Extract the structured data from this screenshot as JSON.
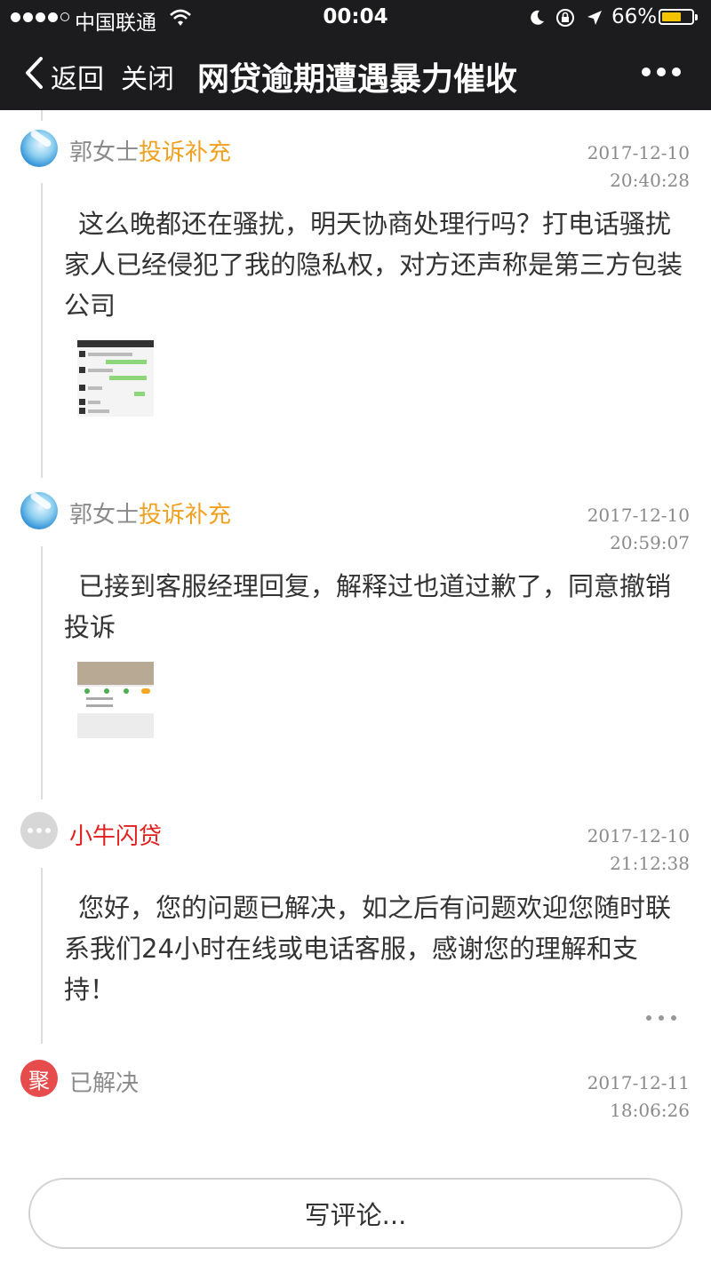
{
  "status_bar": {
    "carrier": "中国联通",
    "time": "00:04",
    "battery": "66%",
    "battery_level": 0.66
  },
  "nav": {
    "back_label": "返回",
    "close_label": "关闭",
    "title": "网贷逾期遭遇暴力催收"
  },
  "timeline": [
    {
      "author": "郭女士",
      "tag": "投诉补充",
      "date": "2017-12-10",
      "time": "20:40:28",
      "text": "这么晚都还在骚扰，明天协商处理行吗？打电话骚扰家人已经侵犯了我的隐私权，对方还声称是第三方包装公司"
    },
    {
      "author": "郭女士",
      "tag": "投诉补充",
      "date": "2017-12-10",
      "time": "20:59:07",
      "text": "已接到客服经理回复，解释过也道过歉了，同意撤销投诉"
    },
    {
      "author": "小牛闪贷",
      "date": "2017-12-10",
      "time": "21:12:38",
      "text": "您好，您的问题已解决，如之后有问题欢迎您随时联系我们24小时在线或电话客服，感谢您的理解和支持！"
    },
    {
      "avatar_char": "聚",
      "author": "已解决",
      "date": "2017-12-11",
      "time": "18:06:26"
    }
  ],
  "comment": {
    "placeholder": "写评论..."
  },
  "colors": {
    "tag": "#f0a020",
    "org": "#e02020",
    "resolved_avatar": "#e74c4c"
  }
}
